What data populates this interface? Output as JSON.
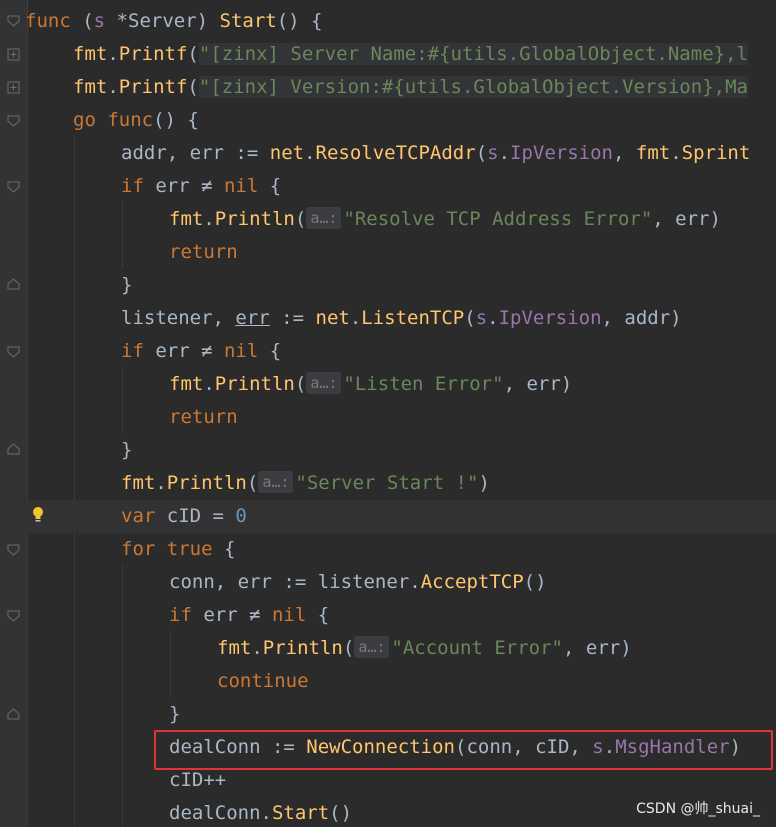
{
  "watermark": "CSDN @帅_shuai_",
  "lines": [
    {
      "indent": 0,
      "tokens": [
        [
          "kw",
          "func"
        ],
        [
          "plain",
          " ("
        ],
        [
          "recv",
          "s"
        ],
        [
          "plain",
          " *"
        ],
        [
          "type",
          "Server"
        ],
        [
          "plain",
          ") "
        ],
        [
          "fn",
          "Start"
        ],
        [
          "plain",
          "() {"
        ]
      ]
    },
    {
      "indent": 1,
      "tokens": [
        [
          "pkg",
          "fmt"
        ],
        [
          "plain",
          "."
        ],
        [
          "fn",
          "Printf"
        ],
        [
          "plain",
          "("
        ],
        [
          "str",
          "\"[zinx] Server Name:#{utils.GlobalObject.Name},l"
        ]
      ]
    },
    {
      "indent": 1,
      "tokens": [
        [
          "pkg",
          "fmt"
        ],
        [
          "plain",
          "."
        ],
        [
          "fn",
          "Printf"
        ],
        [
          "plain",
          "("
        ],
        [
          "str",
          "\"[zinx] Version:#{utils.GlobalObject.Version},Ma"
        ]
      ]
    },
    {
      "indent": 1,
      "tokens": [
        [
          "kw",
          "go"
        ],
        [
          "plain",
          " "
        ],
        [
          "kw",
          "func"
        ],
        [
          "plain",
          "() {"
        ]
      ]
    },
    {
      "indent": 2,
      "tokens": [
        [
          "var",
          "addr"
        ],
        [
          "plain",
          ", "
        ],
        [
          "var",
          "err"
        ],
        [
          "plain",
          " := "
        ],
        [
          "pkg",
          "net"
        ],
        [
          "plain",
          "."
        ],
        [
          "fn",
          "ResolveTCPAddr"
        ],
        [
          "plain",
          "("
        ],
        [
          "recv",
          "s"
        ],
        [
          "plain",
          "."
        ],
        [
          "field",
          "IpVersion"
        ],
        [
          "plain",
          ", "
        ],
        [
          "pkg",
          "fmt"
        ],
        [
          "plain",
          "."
        ],
        [
          "fn",
          "Sprint"
        ]
      ]
    },
    {
      "indent": 2,
      "tokens": [
        [
          "kw",
          "if"
        ],
        [
          "plain",
          " err ≠ "
        ],
        [
          "kw",
          "nil"
        ],
        [
          "plain",
          " {"
        ]
      ]
    },
    {
      "indent": 3,
      "tokens": [
        [
          "pkg",
          "fmt"
        ],
        [
          "plain",
          "."
        ],
        [
          "fn",
          "Println"
        ],
        [
          "plain",
          "("
        ],
        [
          "hint",
          "a…:"
        ],
        [
          "str",
          "\"Resolve TCP Address Error\""
        ],
        [
          "plain",
          ", err)"
        ]
      ]
    },
    {
      "indent": 3,
      "tokens": [
        [
          "kw",
          "return"
        ]
      ]
    },
    {
      "indent": 2,
      "tokens": [
        [
          "plain",
          "}"
        ]
      ]
    },
    {
      "indent": 2,
      "tokens": [
        [
          "var",
          "listener"
        ],
        [
          "plain",
          ", "
        ],
        [
          "under",
          "err"
        ],
        [
          "plain",
          " := "
        ],
        [
          "pkg",
          "net"
        ],
        [
          "plain",
          "."
        ],
        [
          "fn",
          "ListenTCP"
        ],
        [
          "plain",
          "("
        ],
        [
          "recv",
          "s"
        ],
        [
          "plain",
          "."
        ],
        [
          "field",
          "IpVersion"
        ],
        [
          "plain",
          ", addr)"
        ]
      ]
    },
    {
      "indent": 2,
      "tokens": [
        [
          "kw",
          "if"
        ],
        [
          "plain",
          " err ≠ "
        ],
        [
          "kw",
          "nil"
        ],
        [
          "plain",
          " {"
        ]
      ]
    },
    {
      "indent": 3,
      "tokens": [
        [
          "pkg",
          "fmt"
        ],
        [
          "plain",
          "."
        ],
        [
          "fn",
          "Println"
        ],
        [
          "plain",
          "("
        ],
        [
          "hint",
          "a…:"
        ],
        [
          "str",
          "\"Listen Error\""
        ],
        [
          "plain",
          ", err)"
        ]
      ]
    },
    {
      "indent": 3,
      "tokens": [
        [
          "kw",
          "return"
        ]
      ]
    },
    {
      "indent": 2,
      "tokens": [
        [
          "plain",
          "}"
        ]
      ]
    },
    {
      "indent": 2,
      "tokens": [
        [
          "pkg",
          "fmt"
        ],
        [
          "plain",
          "."
        ],
        [
          "fn",
          "Println"
        ],
        [
          "plain",
          "("
        ],
        [
          "hint",
          "a…:"
        ],
        [
          "str",
          "\"Server Start !\""
        ],
        [
          "plain",
          ")"
        ]
      ]
    },
    {
      "indent": 2,
      "tokens": [
        [
          "kw",
          "var"
        ],
        [
          "plain",
          " cID = "
        ],
        [
          "num",
          "0"
        ]
      ]
    },
    {
      "indent": 2,
      "tokens": [
        [
          "kw",
          "for"
        ],
        [
          "plain",
          " "
        ],
        [
          "kw",
          "true"
        ],
        [
          "plain",
          " {"
        ]
      ]
    },
    {
      "indent": 3,
      "tokens": [
        [
          "var",
          "conn"
        ],
        [
          "plain",
          ", "
        ],
        [
          "var",
          "err"
        ],
        [
          "plain",
          " := listener."
        ],
        [
          "fn",
          "AcceptTCP"
        ],
        [
          "plain",
          "()"
        ]
      ]
    },
    {
      "indent": 3,
      "tokens": [
        [
          "kw",
          "if"
        ],
        [
          "plain",
          " err ≠ "
        ],
        [
          "kw",
          "nil"
        ],
        [
          "plain",
          " {"
        ]
      ]
    },
    {
      "indent": 4,
      "tokens": [
        [
          "pkg",
          "fmt"
        ],
        [
          "plain",
          "."
        ],
        [
          "fn",
          "Println"
        ],
        [
          "plain",
          "("
        ],
        [
          "hint",
          "a…:"
        ],
        [
          "str",
          "\"Account Error\""
        ],
        [
          "plain",
          ", err)"
        ]
      ]
    },
    {
      "indent": 4,
      "tokens": [
        [
          "kw",
          "continue"
        ]
      ]
    },
    {
      "indent": 3,
      "tokens": [
        [
          "plain",
          "}"
        ]
      ]
    },
    {
      "indent": 3,
      "tokens": [
        [
          "var",
          "dealConn"
        ],
        [
          "plain",
          " := "
        ],
        [
          "fn",
          "NewConnection"
        ],
        [
          "plain",
          "(conn, cID, "
        ],
        [
          "recv",
          "s"
        ],
        [
          "plain",
          "."
        ],
        [
          "field",
          "MsgHandler"
        ],
        [
          "plain",
          ")"
        ]
      ]
    },
    {
      "indent": 3,
      "tokens": [
        [
          "plain",
          "cID++"
        ]
      ]
    },
    {
      "indent": 3,
      "tokens": [
        [
          "plain",
          "dealConn."
        ],
        [
          "fn",
          "Start"
        ],
        [
          "plain",
          "()"
        ]
      ]
    }
  ]
}
